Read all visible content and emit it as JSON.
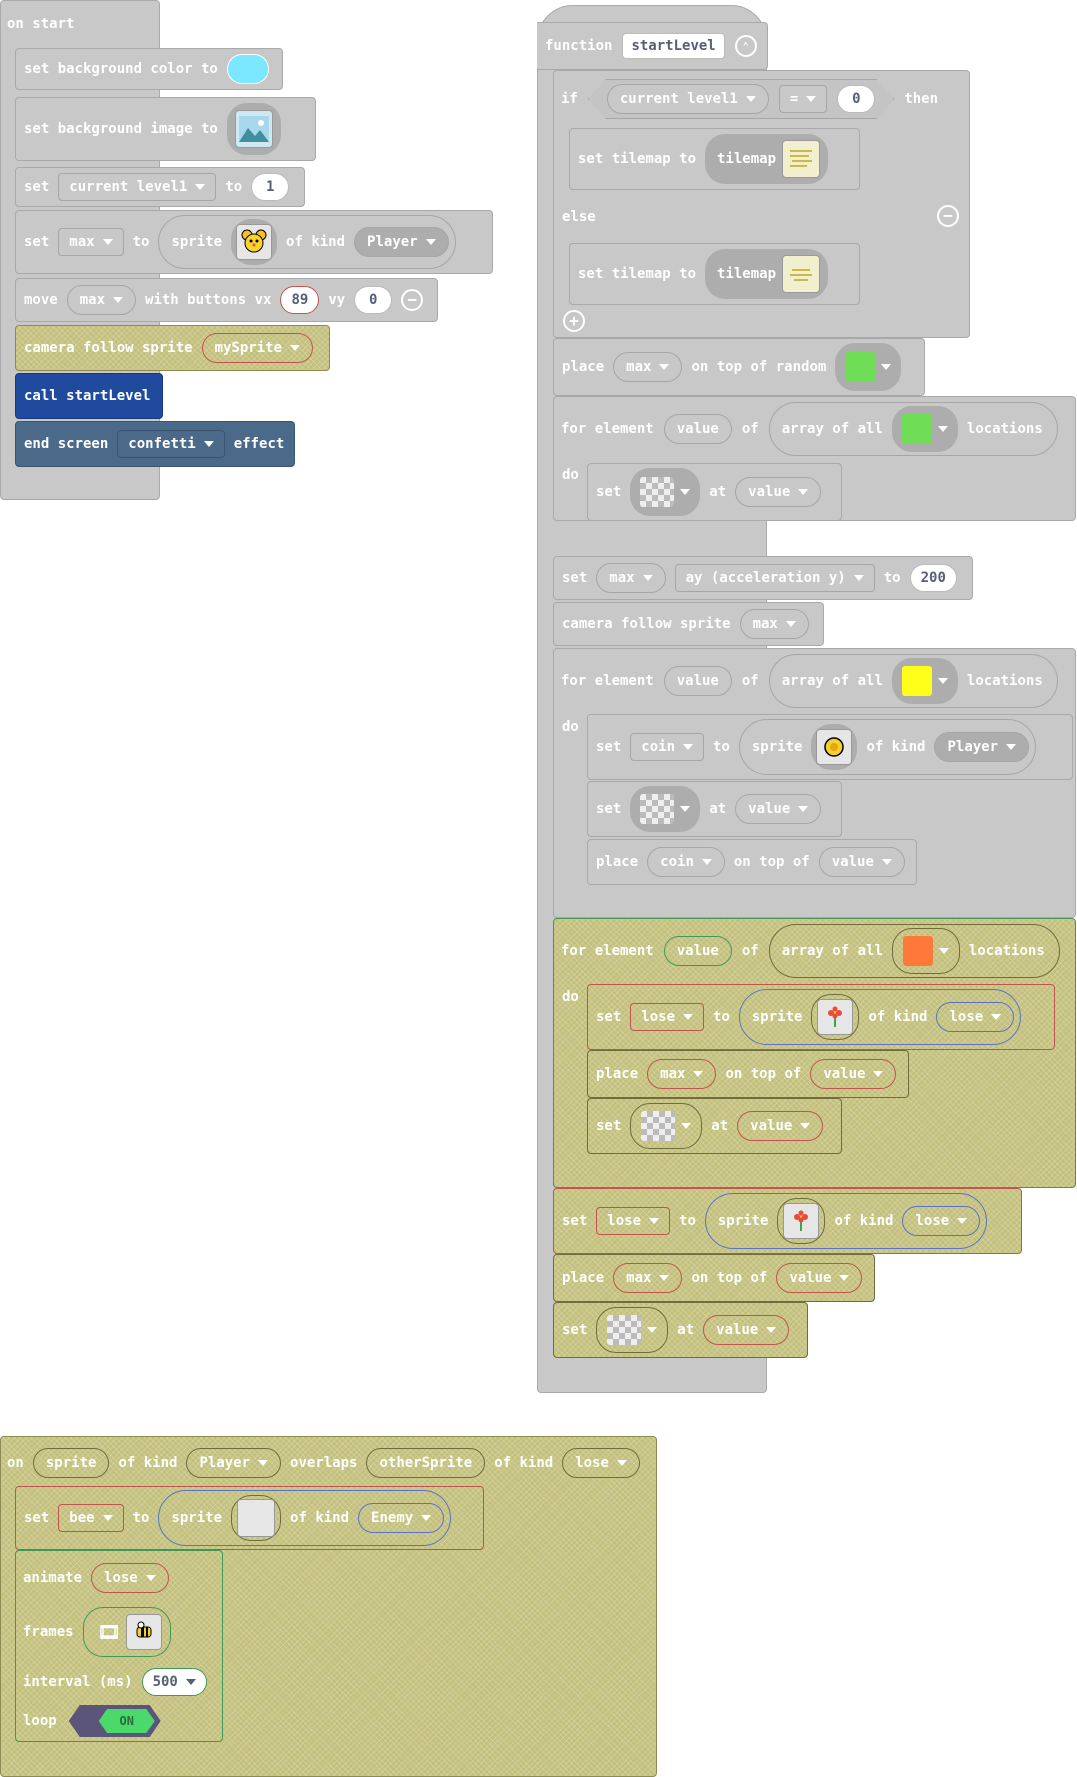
{
  "start": {
    "hat_label": "on start",
    "bg_color": {
      "set_label": "set background color to",
      "color": "#7ce8ff"
    },
    "bg_image": {
      "set_label": "set background image to",
      "icon": "landscape-image-icon"
    },
    "set_level": {
      "set_label": "set",
      "variable": "current level1",
      "to_label": "to",
      "value": "1"
    },
    "set_max": {
      "set_label": "set",
      "variable": "max",
      "to_label": "to",
      "sprite_label": "sprite",
      "of_kind_label": "of kind",
      "kind": "Player",
      "icon": "yellow-mouse-sprite-icon"
    },
    "move": {
      "move_label": "move",
      "variable": "max",
      "with_buttons_label": "with buttons vx",
      "vx": "89",
      "vy_label": "vy",
      "vy": "0"
    },
    "camera": {
      "label": "camera follow sprite",
      "sprite": "mySprite"
    },
    "call": {
      "label": "call startLevel"
    },
    "end_screen": {
      "label": "end screen",
      "effect": "confetti",
      "effect_label": "effect"
    }
  },
  "func": {
    "hat_label": "function",
    "name": "startLevel",
    "if_row": {
      "if_label": "if",
      "variable": "current level1",
      "op": "=",
      "value": "0",
      "then_label": "then"
    },
    "tilemap1": {
      "label": "set tilemap to",
      "tilemap_label": "tilemap"
    },
    "else_label": "else",
    "tilemap2": {
      "label": "set tilemap to",
      "tilemap_label": "tilemap"
    },
    "place_random": {
      "place_label": "place",
      "variable": "max",
      "on_top_label": "on top of random",
      "tile_color": "#6fdd56"
    },
    "loop1": {
      "for_label": "for element",
      "element": "value",
      "of_label": "of",
      "array_label": "array of all",
      "tile_color": "#6fdd56",
      "locations_label": "locations",
      "do_label": "do"
    },
    "loop1_set": {
      "set_label": "set",
      "at_label": "at",
      "value": "value"
    },
    "set_ay": {
      "set_label": "set",
      "variable": "max",
      "property": "ay (acceleration y)",
      "to_label": "to",
      "value": "200"
    },
    "camera": {
      "label": "camera follow sprite",
      "sprite": "max"
    },
    "loop2": {
      "for_label": "for element",
      "element": "value",
      "of_label": "of",
      "array_label": "array of all",
      "tile_color": "#ffff1a",
      "locations_label": "locations",
      "do_label": "do"
    },
    "loop2_set_coin": {
      "set_label": "set",
      "variable": "coin",
      "to_label": "to",
      "sprite_label": "sprite",
      "of_kind_label": "of kind",
      "kind": "Player",
      "icon": "coin-sprite-icon"
    },
    "loop2_set_tile": {
      "set_label": "set",
      "at_label": "at",
      "value": "value"
    },
    "loop2_place": {
      "place_label": "place",
      "variable": "coin",
      "on_top_label": "on top of",
      "value": "value"
    },
    "loop3": {
      "for_label": "for element",
      "element": "value",
      "of_label": "of",
      "array_label": "array of all",
      "tile_color": "#ff7a3a",
      "locations_label": "locations",
      "do_label": "do"
    },
    "loop3_set_lose": {
      "set_label": "set",
      "variable": "lose",
      "to_label": "to",
      "sprite_label": "sprite",
      "of_kind_label": "of kind",
      "kind": "lose",
      "icon": "flower-sprite-icon"
    },
    "loop3_place": {
      "place_label": "place",
      "variable": "max",
      "on_top_label": "on top of",
      "value": "value"
    },
    "loop3_set_tile": {
      "set_label": "set",
      "at_label": "at",
      "value": "value"
    },
    "after_set_lose": {
      "set_label": "set",
      "variable": "lose",
      "to_label": "to",
      "sprite_label": "sprite",
      "of_kind_label": "of kind",
      "kind": "lose",
      "icon": "flower-sprite-icon"
    },
    "after_place": {
      "place_label": "place",
      "variable": "max",
      "on_top_label": "on top of",
      "value": "value"
    },
    "after_set_tile": {
      "set_label": "set",
      "at_label": "at",
      "value": "value"
    }
  },
  "overlap": {
    "on_label": "on",
    "sprite": "sprite",
    "of_kind_label": "of kind",
    "kind1": "Player",
    "overlaps_label": "overlaps",
    "other": "otherSprite",
    "of_kind_label2": "of kind",
    "kind2": "lose",
    "set_bee": {
      "set_label": "set",
      "variable": "bee",
      "to_label": "to",
      "sprite_label": "sprite",
      "of_kind_label": "of kind",
      "kind": "Enemy"
    },
    "animate": {
      "animate_label": "animate",
      "variable": "lose",
      "frames_label": "frames",
      "interval_label": "interval (ms)",
      "interval": "500",
      "loop_label": "loop",
      "toggle": "ON"
    }
  }
}
